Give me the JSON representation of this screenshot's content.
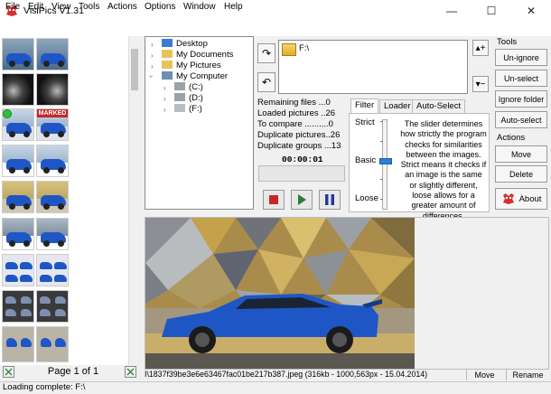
{
  "window": {
    "title": "VisiPics V1.31",
    "minimize_glyph": "—",
    "maximize_glyph": "☐",
    "close_glyph": "✕"
  },
  "menu": [
    {
      "label": "File"
    },
    {
      "label": "Edit"
    },
    {
      "label": "View"
    },
    {
      "label": "Tools"
    },
    {
      "label": "Actions"
    },
    {
      "label": "Options"
    },
    {
      "label": "Window"
    },
    {
      "label": "Help"
    }
  ],
  "thumbnail_panel": {
    "page_label": "Page 1 of 1",
    "marked_badge": "MARKED"
  },
  "folder_tree": {
    "items": [
      {
        "label": "Desktop",
        "icon": "desktop-icon"
      },
      {
        "label": "My Documents",
        "icon": "documents-icon"
      },
      {
        "label": "My Pictures",
        "icon": "pictures-icon"
      },
      {
        "label": "My Computer",
        "icon": "computer-icon"
      },
      {
        "label": "(C:)",
        "icon": "drive-icon"
      },
      {
        "label": "(D:)",
        "icon": "drive-icon"
      },
      {
        "label": "(F:)",
        "icon": "removable-drive-icon"
      }
    ]
  },
  "folder_list": {
    "items": [
      {
        "label": "F:\\",
        "icon": "folder-icon"
      }
    ]
  },
  "stats": {
    "remaining": "Remaining files ...0",
    "loaded": "Loaded pictures ..26",
    "to_compare": "To compare ..........0",
    "duplicates": "Duplicate pictures..26",
    "groups": "Duplicate groups ...13",
    "timer": "00:00:01"
  },
  "tabs": [
    {
      "label": "Filter",
      "active": true
    },
    {
      "label": "Loader",
      "active": false
    },
    {
      "label": "Auto-Select",
      "active": false
    }
  ],
  "filter": {
    "strict_label": "Strict",
    "basic_label": "Basic",
    "loose_label": "Loose",
    "level": "Basic",
    "description": "The slider determines how strictly the program checks for similarities between the images. Strict means it checks if an image is the same or slightly different, loose allows for a greater amount of differences."
  },
  "tools": {
    "group_label": "Tools",
    "unignore": "Un-ignore",
    "unselect": "Un-select",
    "ignore_folder": "Ignore folder",
    "auto_select": "Auto-select"
  },
  "actions": {
    "group_label": "Actions",
    "move": "Move",
    "delete": "Delete",
    "about": "About"
  },
  "preview": {
    "file_info": "I\\1837f39be3e6e63467fac01be217b387.jpeg (316kb - 1000,563px - 15.04.2014)",
    "move_label": "Move",
    "rename_label": "Rename"
  },
  "status": {
    "text": "Loading complete: F:\\"
  },
  "colors": {
    "accent_blue": "#2a7fd6",
    "car_blue": "#1f56c6",
    "stop_red": "#c62828",
    "play_green": "#2e7d32",
    "pause_blue": "#1e3c9e"
  }
}
